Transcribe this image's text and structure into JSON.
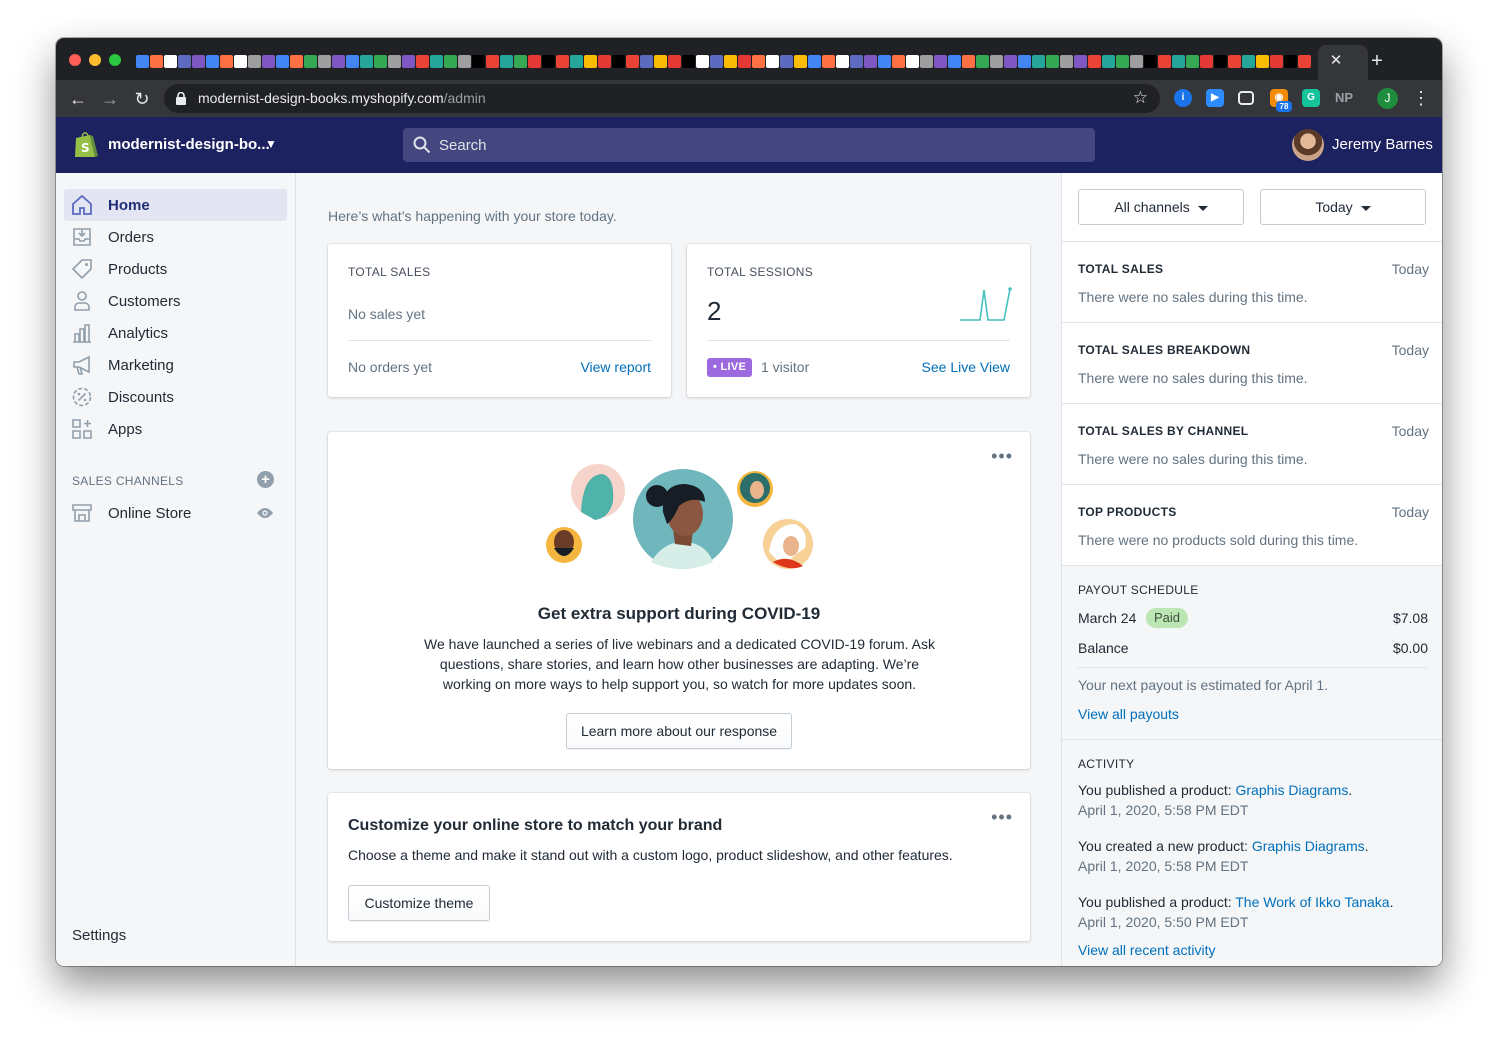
{
  "browser": {
    "tab_close": "✕",
    "new_tab": "+",
    "url_domain": "modernist-design-books.myshopify.com",
    "url_path": "/admin",
    "extension_badge": "78",
    "np_ext": "NP",
    "profile_initial": "J"
  },
  "topbar": {
    "store_name": "modernist-design-bo...",
    "search_placeholder": "Search",
    "user_name": "Jeremy Barnes"
  },
  "sidebar": {
    "items": [
      {
        "label": "Home",
        "icon": "home-icon"
      },
      {
        "label": "Orders",
        "icon": "orders-icon"
      },
      {
        "label": "Products",
        "icon": "tag-icon"
      },
      {
        "label": "Customers",
        "icon": "person-icon"
      },
      {
        "label": "Analytics",
        "icon": "bar-chart-icon"
      },
      {
        "label": "Marketing",
        "icon": "megaphone-icon"
      },
      {
        "label": "Discounts",
        "icon": "discount-icon"
      },
      {
        "label": "Apps",
        "icon": "apps-icon"
      }
    ],
    "section_title": "SALES CHANNELS",
    "channel": "Online Store",
    "settings": "Settings"
  },
  "main": {
    "greeting": "Here’s what’s happening with your store today.",
    "total_sales": {
      "label": "TOTAL SALES",
      "empty": "No sales yet",
      "orders": "No orders yet",
      "link": "View report"
    },
    "total_sessions": {
      "label": "TOTAL SESSIONS",
      "value": "2",
      "badge": "• LIVE",
      "visitors": "1 visitor",
      "link": "See Live View"
    },
    "covid": {
      "title": "Get extra support during COVID-19",
      "body": "We have launched a series of live webinars and a dedicated COVID-19 forum. Ask questions, share stories, and learn how other businesses are adapting. We’re working on more ways to help support you, so watch for more updates soon.",
      "button": "Learn more about our response",
      "more": "•••"
    },
    "customize": {
      "title": "Customize your online store to match your brand",
      "body": "Choose a theme and make it stand out with a custom logo, product slideshow, and other features.",
      "button": "Customize theme",
      "more": "•••"
    }
  },
  "right": {
    "channel_filter": "All channels",
    "date_filter": "Today",
    "sections": [
      {
        "title": "TOTAL SALES",
        "when": "Today",
        "text": "There were no sales during this time."
      },
      {
        "title": "TOTAL SALES BREAKDOWN",
        "when": "Today",
        "text": "There were no sales during this time."
      },
      {
        "title": "TOTAL SALES BY CHANNEL",
        "when": "Today",
        "text": "There were no sales during this time."
      },
      {
        "title": "TOP PRODUCTS",
        "when": "Today",
        "text": "There were no products sold during this time."
      }
    ],
    "payout": {
      "title": "PAYOUT SCHEDULE",
      "date": "March 24",
      "status": "Paid",
      "amount": "$7.08",
      "balance_label": "Balance",
      "balance": "$0.00",
      "next": "Your next payout is estimated for April 1.",
      "link": "View all payouts"
    },
    "activity": {
      "title": "ACTIVITY",
      "items": [
        {
          "prefix": "You published a product: ",
          "product": "Graphis Diagrams",
          "time": "April 1, 2020, 5:58 PM EDT"
        },
        {
          "prefix": "You created a new product: ",
          "product": "Graphis Diagrams",
          "time": "April 1, 2020, 5:58 PM EDT"
        },
        {
          "prefix": "You published a product: ",
          "product": "The Work of Ikko Tanaka",
          "time": "April 1, 2020, 5:50 PM EDT"
        }
      ],
      "link": "View all recent activity"
    }
  },
  "colors": {
    "topbar": "#1c2260",
    "link": "#006fbb",
    "live": "#9c6ade",
    "paid": "#bbe5b3"
  }
}
